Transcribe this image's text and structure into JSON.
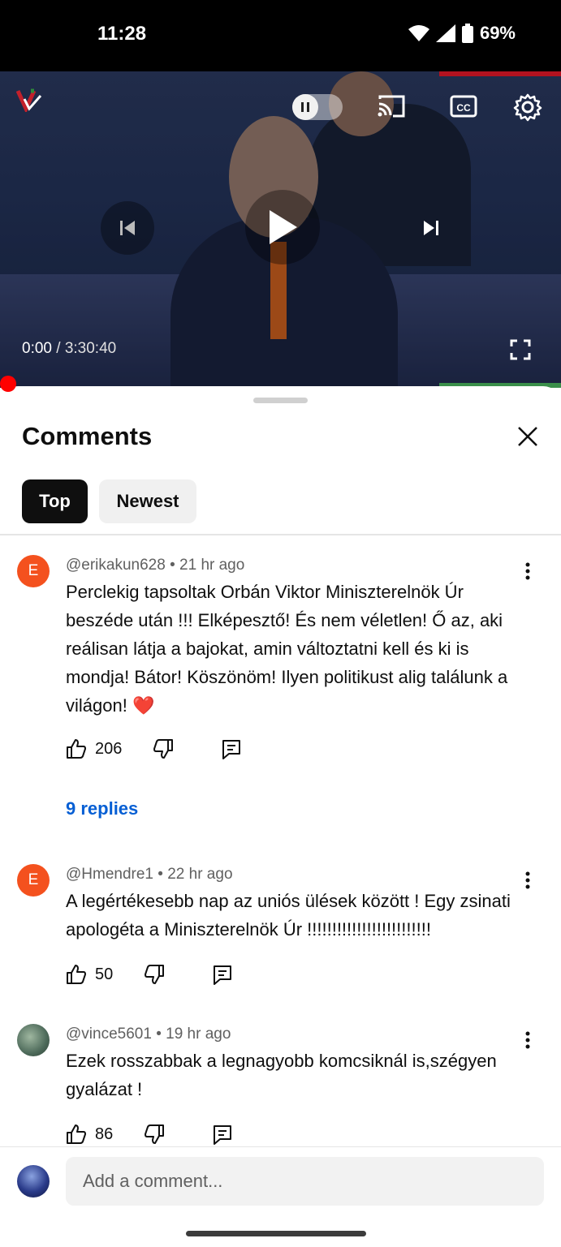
{
  "status_bar": {
    "time": "11:28",
    "battery": "69%"
  },
  "player": {
    "current_time": "0:00",
    "separator": " / ",
    "duration": "3:30:40"
  },
  "sheet": {
    "title": "Comments",
    "chips": [
      {
        "label": "Top",
        "selected": true
      },
      {
        "label": "Newest",
        "selected": false
      }
    ]
  },
  "comments": [
    {
      "avatar_letter": "E",
      "handle": "@erikakun628",
      "age": "21 hr ago",
      "text": "Perclekig tapsoltak Orbán Viktor Miniszterelnök Úr beszéde után !!! Elképesztő! És nem véletlen! Ő az, aki reálisan látja a bajokat, amin változtatni kell és ki is mondja! Bátor! Köszönöm! Ilyen politikust alig találunk a világon! ❤️",
      "likes": "206",
      "replies": "9 replies"
    },
    {
      "avatar_letter": "E",
      "handle": "@Hmendre1",
      "age": "22 hr ago",
      "text": "A legértékesebb nap az uniós ülések között ! Egy zsinati apologéta a Miniszterelnök Úr !!!!!!!!!!!!!!!!!!!!!!!!!",
      "likes": "50"
    },
    {
      "avatar_letter": "",
      "handle": "@vince5601",
      "age": "19 hr ago",
      "text": "Ezek rosszabbak a legnagyobb komcsiknál is,szégyen gyalázat !",
      "likes": "86"
    }
  ],
  "composer": {
    "placeholder": "Add a comment..."
  },
  "colors": {
    "accent": "#ff0000",
    "link": "#065fd4",
    "avatar_e": "#f4511e"
  }
}
